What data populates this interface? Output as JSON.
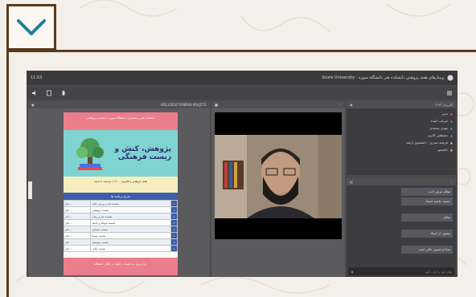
{
  "app": {
    "window_title": "Score University - وبینارهای هفته پژوهش دانشکده هنر دانشگاه سوره",
    "clock": "11:53"
  },
  "document": {
    "filename": "WELLDESITIONBAN-8R4J5TG",
    "poster_header": "دانشکده هنر و معماری | دانشگاه سوره | معاونت پژوهشی",
    "poster_title_line1": "پژوهش، کنش و",
    "poster_title_line2": "زیست فرهنگی",
    "poster_subtitle": "هفته پژوهش و فناوری ۱۴۰۰ | دوشنبه تا شنبه",
    "poster_table_title": "شرح برنامه ها",
    "rows": [
      {
        "n": "۱",
        "title": "نشست نقد و بررسی کتاب",
        "speaker": "دکتر ..."
      },
      {
        "n": "۲",
        "title": "نشست پژوهشی",
        "speaker": "دکتر ..."
      },
      {
        "n": "۳",
        "title": "نشست هنر و رسانه",
        "speaker": "دکتر ..."
      },
      {
        "n": "۴",
        "title": "نشست فرهنگ و جامعه",
        "speaker": "دکتر ..."
      },
      {
        "n": "۵",
        "title": "نشست معماری",
        "speaker": "دکتر ..."
      },
      {
        "n": "۶",
        "title": "نشست سینما",
        "speaker": "دکتر ..."
      },
      {
        "n": "۷",
        "title": "نشست موسیقی",
        "speaker": "دکتر ..."
      },
      {
        "n": "۸",
        "title": "نشست پایانی",
        "speaker": "دکتر ..."
      }
    ],
    "poster_footer": "برای ورود به جلسات | لینک در کانال دانشگاه"
  },
  "users": {
    "header": "کاربران (۲۷)",
    "list": [
      {
        "name": "مدیر",
        "color": "#e74a4a"
      },
      {
        "name": "شرکت کننده",
        "color": "#4a8ee7"
      },
      {
        "name": "مهدی محمدی",
        "color": "#4a8ee7"
      },
      {
        "name": "مصطفی اکبری",
        "color": "#4a8ee7"
      },
      {
        "name": "فرشته صدری - دانشجوی ارشد",
        "color": "#e7c84a"
      },
      {
        "name": "دانشجو",
        "color": "#e7c84a"
      }
    ]
  },
  "chat": {
    "messages": [
      "سلام عرض ادب",
      "خسته نباشید استاد",
      "سلام",
      "ممنون از استاد",
      "صدا و تصویر عالی است"
    ],
    "placeholder": "پیام خود را وارد کنید"
  }
}
